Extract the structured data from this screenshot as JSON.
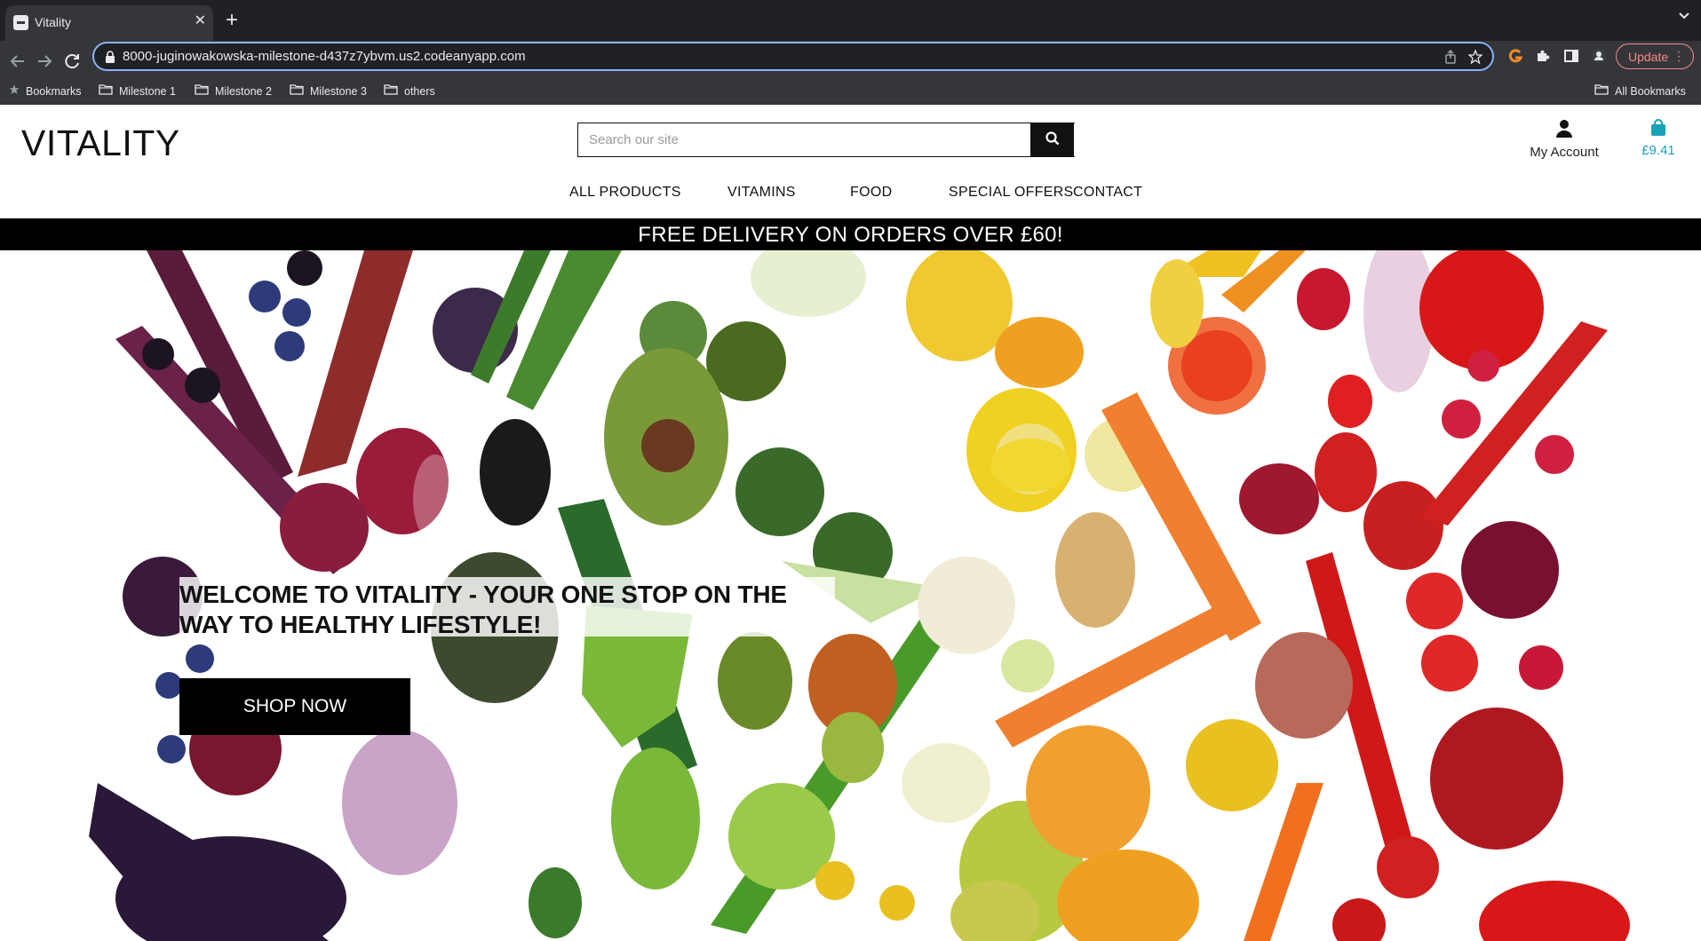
{
  "browser": {
    "tab_title": "Vitality",
    "url": "8000-juginowakowska-milestone-d437z7ybvm.us2.codeanyapp.com",
    "update_label": "Update",
    "bookmarks": [
      {
        "label": "Bookmarks",
        "icon": "star-icon"
      },
      {
        "label": "Milestone 1",
        "icon": "folder-icon"
      },
      {
        "label": "Milestone 2",
        "icon": "folder-icon"
      },
      {
        "label": "Milestone 3",
        "icon": "folder-icon"
      },
      {
        "label": "others",
        "icon": "folder-icon"
      }
    ],
    "all_bookmarks": "All Bookmarks"
  },
  "site": {
    "logo": "VITALITY",
    "search_placeholder": "Search our site",
    "account_label": "My Account",
    "cart_total": "£9.41",
    "nav": [
      "ALL PRODUCTS",
      "VITAMINS",
      "FOOD",
      "SPECIAL OFFERS",
      "CONTACT"
    ],
    "banner": "FREE DELIVERY ON ORDERS OVER £60!",
    "hero_title": "WELCOME TO VITALITY - YOUR ONE STOP ON THE WAY TO HEALTHY LIFESTYLE!",
    "shop_now": "SHOP NOW"
  },
  "colors": {
    "accent": "#17a2b8",
    "banner_bg": "#000000",
    "browser_focus": "#8ab4f8",
    "update_red": "#f28b82"
  }
}
